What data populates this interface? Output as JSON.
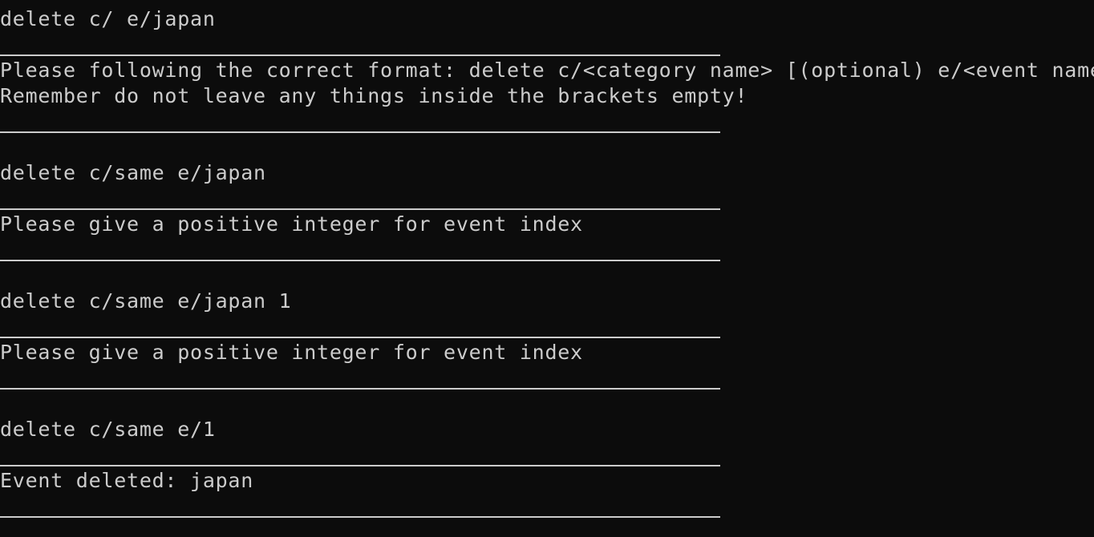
{
  "terminal": {
    "lines": [
      "delete c/ e/japan",
      "Please following the correct format: delete c/<category name> [(optional) e/<event name>]",
      "Remember do not leave any things inside the brackets empty!",
      "delete c/same e/japan",
      "Please give a positive integer for event index",
      "delete c/same e/japan 1",
      "Please give a positive integer for event index",
      "delete c/same e/1",
      "Event deleted: japan"
    ]
  },
  "colors": {
    "background": "#0c0c0c",
    "text": "#cccccc"
  }
}
